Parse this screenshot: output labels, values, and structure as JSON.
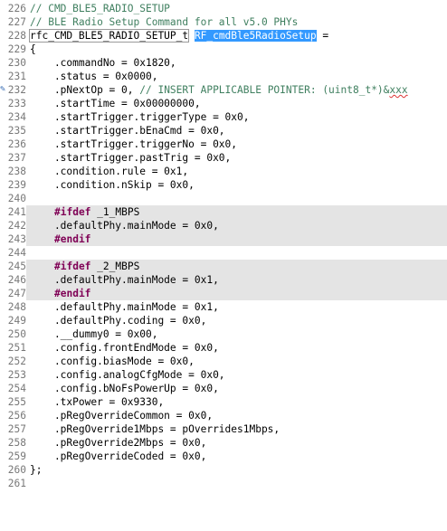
{
  "colors": {
    "comment": "#3f7f5f",
    "keyword": "#7f0055",
    "line_number": "#787878",
    "selection": "#3399ff",
    "inactive_block": "#e4e4e4"
  },
  "lines": [
    {
      "no": "226",
      "code": "// CMD_BLE5_RADIO_SETUP"
    },
    {
      "no": "227",
      "code": "// BLE Radio Setup Command for all v5.0 PHYs"
    },
    {
      "no": "228",
      "type_name": "rfc_CMD_BLE5_RADIO_SETUP_t",
      "var_name": "RF_cmdBle5RadioSetup",
      "tail": " ="
    },
    {
      "no": "229",
      "code": "{"
    },
    {
      "no": "230",
      "code": "    .commandNo = 0x1820,"
    },
    {
      "no": "231",
      "code": "    .status = 0x0000,"
    },
    {
      "no": "232",
      "code_before": "    .pNextOp = 0, ",
      "comment": "// INSERT APPLICABLE POINTER: (uint8_t*)&",
      "squiggle": "xxx"
    },
    {
      "no": "233",
      "code": "    .startTime = 0x00000000,"
    },
    {
      "no": "234",
      "code": "    .startTrigger.triggerType = 0x0,"
    },
    {
      "no": "235",
      "code": "    .startTrigger.bEnaCmd = 0x0,"
    },
    {
      "no": "236",
      "code": "    .startTrigger.triggerNo = 0x0,"
    },
    {
      "no": "237",
      "code": "    .startTrigger.pastTrig = 0x0,"
    },
    {
      "no": "238",
      "code": "    .condition.rule = 0x1,"
    },
    {
      "no": "239",
      "code": "    .condition.nSkip = 0x0,"
    },
    {
      "no": "240",
      "code": ""
    },
    {
      "no": "241",
      "keyword": "#ifdef",
      "macro": " _1_MBPS"
    },
    {
      "no": "242",
      "code": "    .defaultPhy.mainMode = 0x0,"
    },
    {
      "no": "243",
      "keyword": "#endif",
      "macro": ""
    },
    {
      "no": "244",
      "code": ""
    },
    {
      "no": "245",
      "keyword": "#ifdef",
      "macro": " _2_MBPS"
    },
    {
      "no": "246",
      "code": "    .defaultPhy.mainMode = 0x1,"
    },
    {
      "no": "247",
      "keyword": "#endif",
      "macro": ""
    },
    {
      "no": "248",
      "code": "    .defaultPhy.mainMode = 0x1,"
    },
    {
      "no": "249",
      "code": "    .defaultPhy.coding = 0x0,"
    },
    {
      "no": "250",
      "code": "    .__dummy0 = 0x00,"
    },
    {
      "no": "251",
      "code": "    .config.frontEndMode = 0x0,"
    },
    {
      "no": "252",
      "code": "    .config.biasMode = 0x0,"
    },
    {
      "no": "253",
      "code": "    .config.analogCfgMode = 0x0,"
    },
    {
      "no": "254",
      "code": "    .config.bNoFsPowerUp = 0x0,"
    },
    {
      "no": "255",
      "code": "    .txPower = 0x9330,"
    },
    {
      "no": "256",
      "code": "    .pRegOverrideCommon = 0x0,"
    },
    {
      "no": "257",
      "code": "    .pRegOverride1Mbps = pOverrides1Mbps,"
    },
    {
      "no": "258",
      "code": "    .pRegOverride2Mbps = 0x0,"
    },
    {
      "no": "259",
      "code": "    .pRegOverrideCoded = 0x0,"
    },
    {
      "no": "260",
      "code": "};"
    },
    {
      "no": "261",
      "code": ""
    }
  ]
}
